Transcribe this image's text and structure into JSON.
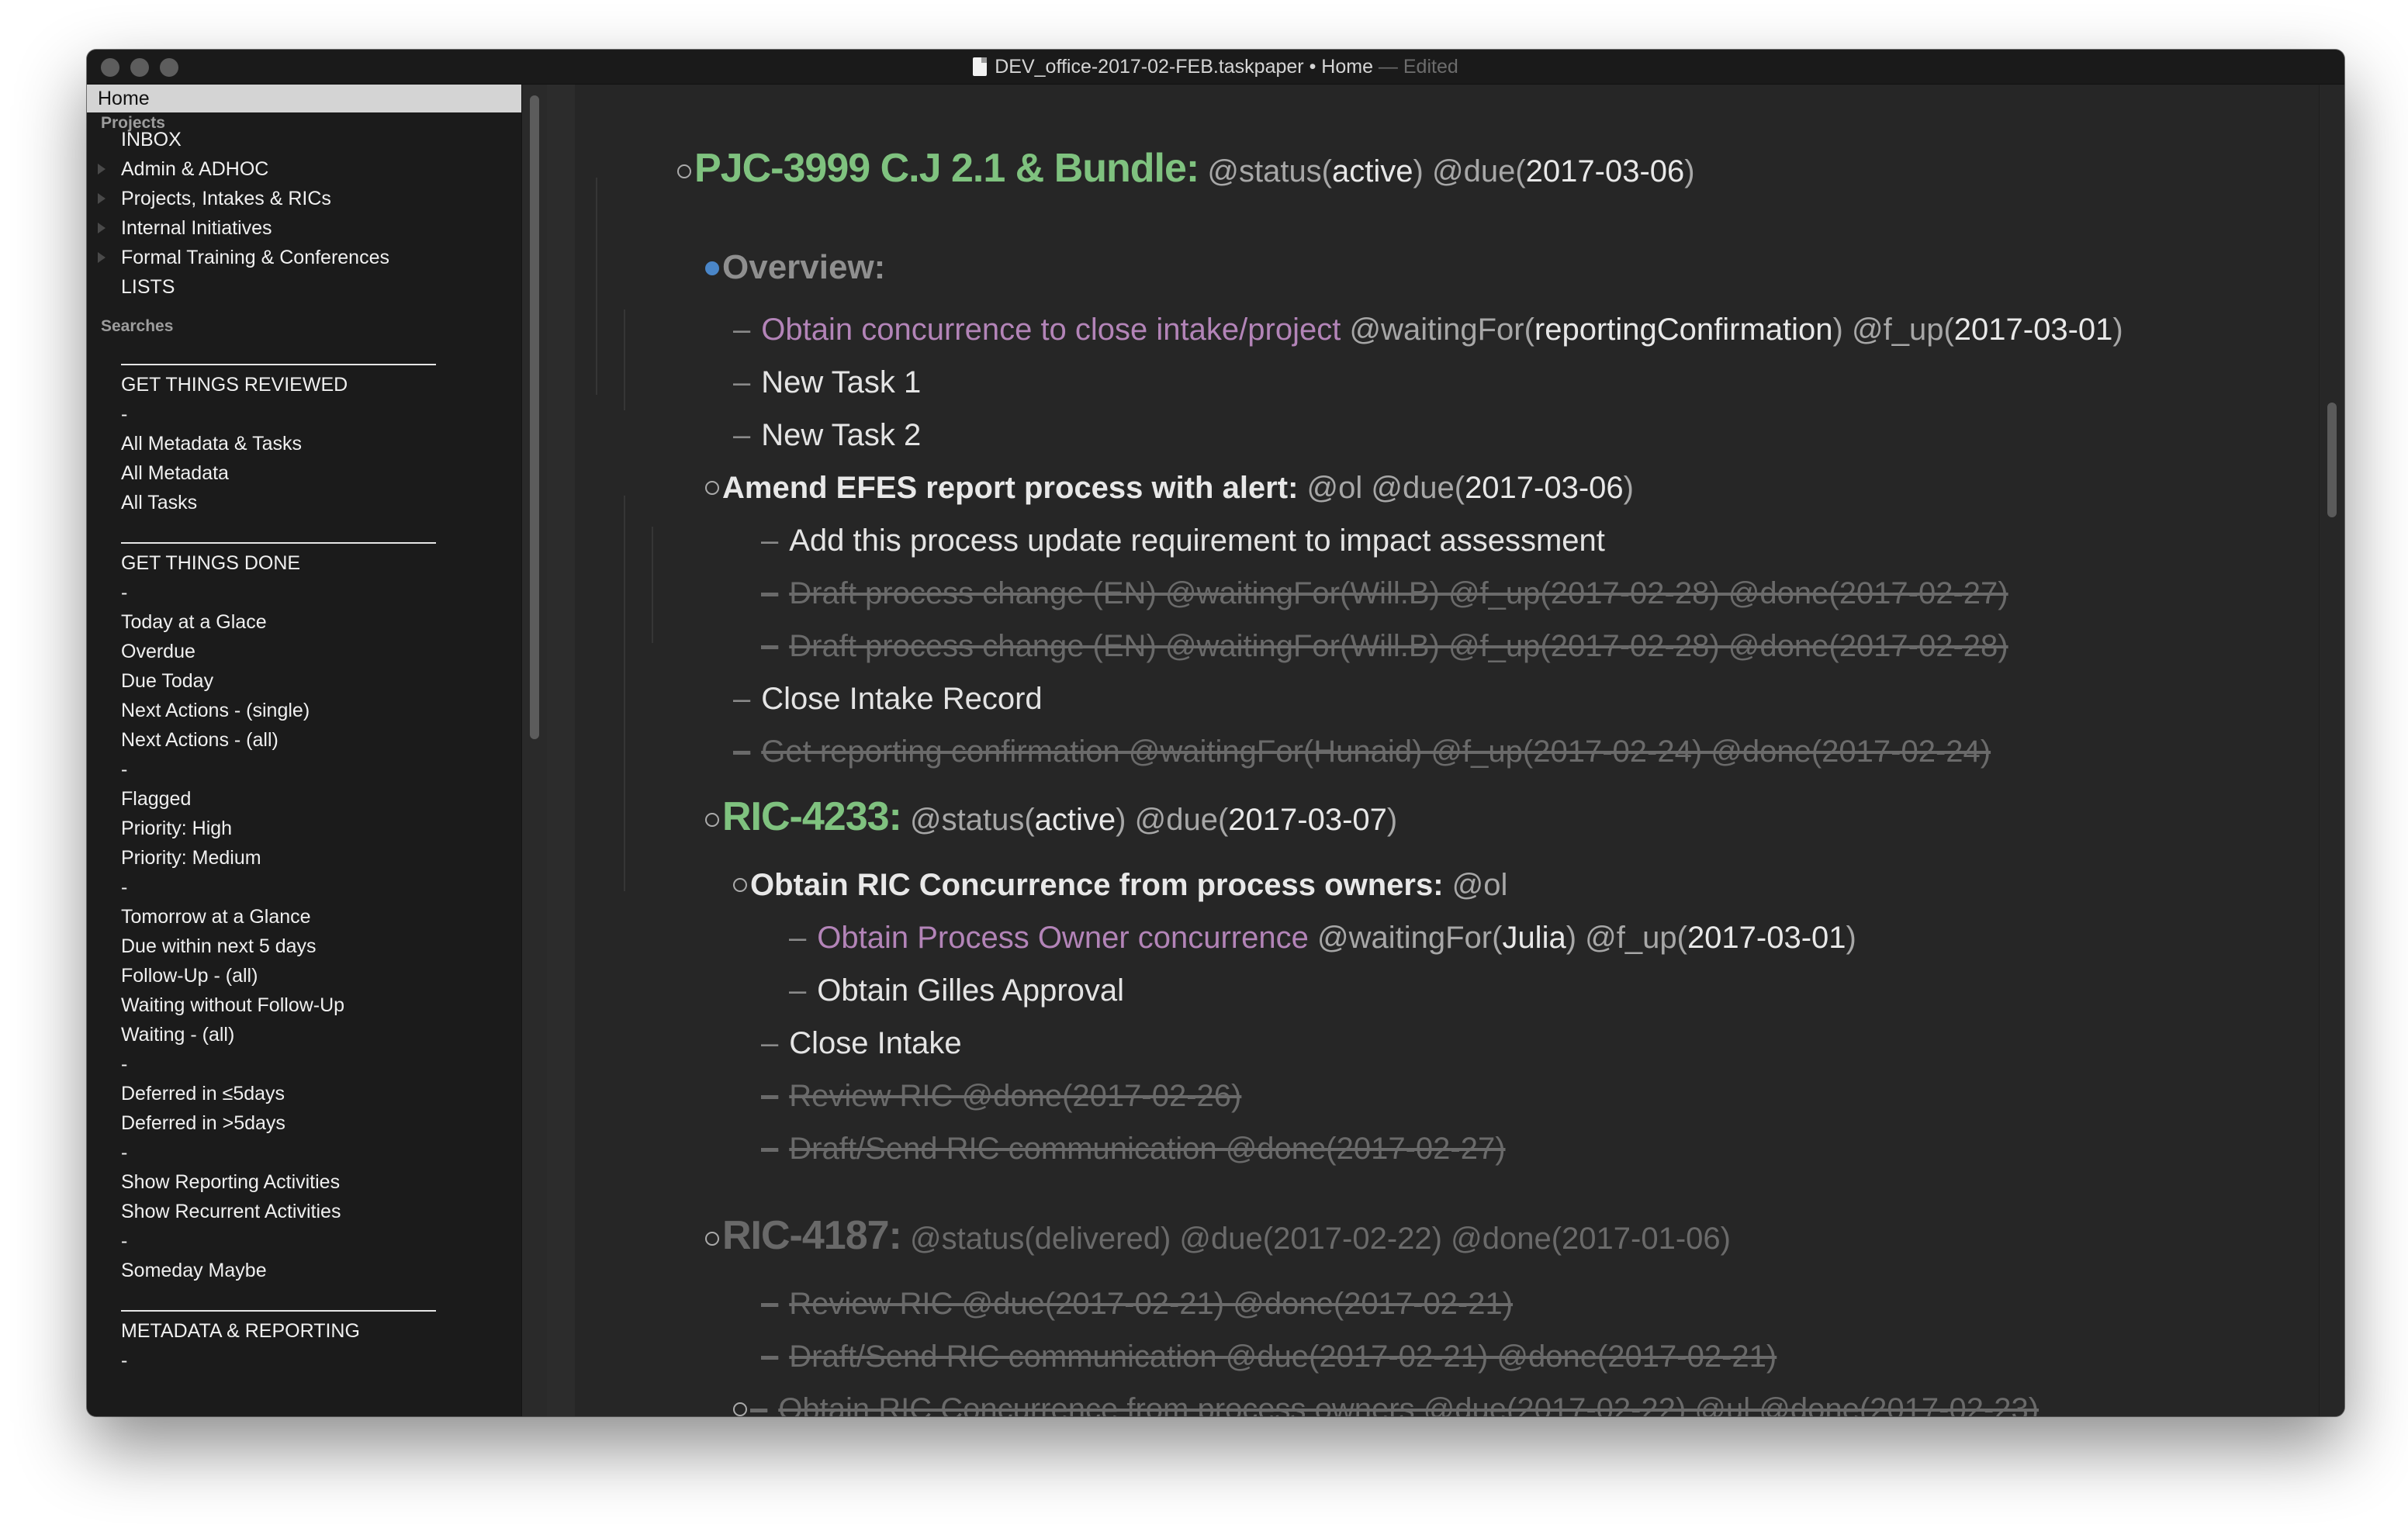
{
  "window": {
    "title_file": "DEV_office-2017-02-FEB.taskpaper",
    "title_sep": " • ",
    "title_section": "Home",
    "title_edited": " — Edited"
  },
  "sidebar": {
    "home": "Home",
    "projects_header": "Projects",
    "projects": [
      "INBOX",
      "Admin & ADHOC",
      "Projects, Intakes & RICs",
      "Internal Initiatives",
      "Formal Training & Conferences",
      "LISTS"
    ],
    "searches_header": "Searches",
    "searches": [
      "GET THINGS REVIEWED",
      "-",
      "All Metadata & Tasks",
      "All Metadata",
      "All Tasks",
      "GET THINGS DONE",
      "-",
      "Today at a Glace",
      "Overdue",
      "Due Today",
      "Next Actions - (single)",
      "Next Actions - (all)",
      "-",
      "Flagged",
      "Priority: High",
      "Priority: Medium",
      "-",
      "Tomorrow at a Glance",
      "Due within next 5 days",
      "Follow-Up - (all)",
      "Waiting without Follow-Up",
      "Waiting - (all)",
      "-",
      "Deferred in ≤5days",
      "Deferred in >5days",
      "-",
      "Show Reporting Activities",
      "Show Recurrent Activities",
      "-",
      "Someday Maybe",
      "METADATA & REPORTING",
      "-"
    ]
  },
  "doc": {
    "p1_title": "PJC-3999 C.J 2.1 & Bundle:",
    "p1_tag1": "@status(",
    "p1_val1": "active",
    "p1_tag1b": ")",
    "p1_tag2": "@due(",
    "p1_val2": "2017-03-06",
    "p1_tag2b": ")",
    "overview": "Overview:",
    "t1_text": "Obtain concurrence to close intake/project",
    "t1_tag1": "@waitingFor(",
    "t1_val1": "reportingConfirmation",
    "t1_tag1b": ")",
    "t1_tag2": "@f_up(",
    "t1_val2": "2017-03-01",
    "t1_tag2b": ")",
    "t2_text": "New Task 1",
    "t3_text": "New Task 2",
    "s1_title": "Amend EFES report process with alert:",
    "s1_tag1": "@ol",
    "s1_tag2": "@due(",
    "s1_val2": "2017-03-06",
    "s1_tag2b": ")",
    "t4_text": "Add this process update requirement to impact assessment",
    "t5_text": "Draft process change (EN) @waitingFor(Will.B) @f_up(2017-02-28) @done(2017-02-27)",
    "t6_text": "Draft process change (EN) @waitingFor(Will.B) @f_up(2017-02-28) @done(2017-02-28)",
    "t7_text": "Close Intake Record",
    "t8_text": "Get reporting  confirmation @waitingFor(Hunaid) @f_up(2017-02-24) @done(2017-02-24)",
    "p2_title": "RIC-4233:",
    "p2_tag1": "@status(",
    "p2_val1": "active",
    "p2_tag1b": ")",
    "p2_tag2": "@due(",
    "p2_val2": "2017-03-07",
    "p2_tag2b": ")",
    "s2_title": "Obtain RIC Concurrence from process owners:",
    "s2_tag1": "@ol",
    "t9_text": "Obtain Process Owner concurrence",
    "t9_tag1": "@waitingFor(",
    "t9_val1": "Julia",
    "t9_tag1b": ")",
    "t9_tag2": "@f_up(",
    "t9_val2": "2017-03-01",
    "t9_tag2b": ")",
    "t10_text": "Obtain Gilles Approval",
    "t11_text": "Close Intake",
    "t12_text": "Review RIC @done(2017-02-26)",
    "t13_text": "Draft/Send RIC communication @done(2017-02-27)",
    "p3_title": "RIC-4187:",
    "p3_tags": "@status(delivered) @due(2017-02-22) @done(2017-01-06)",
    "t14_text": "Review RIC @due(2017-02-21) @done(2017-02-21)",
    "t15_text": "Draft/Send RIC communication @due(2017-02-21) @done(2017-02-21)",
    "t16_text": "Obtain RIC Concurrence from process owners @due(2017-02-22) @ul @done(2017-02-23)"
  }
}
